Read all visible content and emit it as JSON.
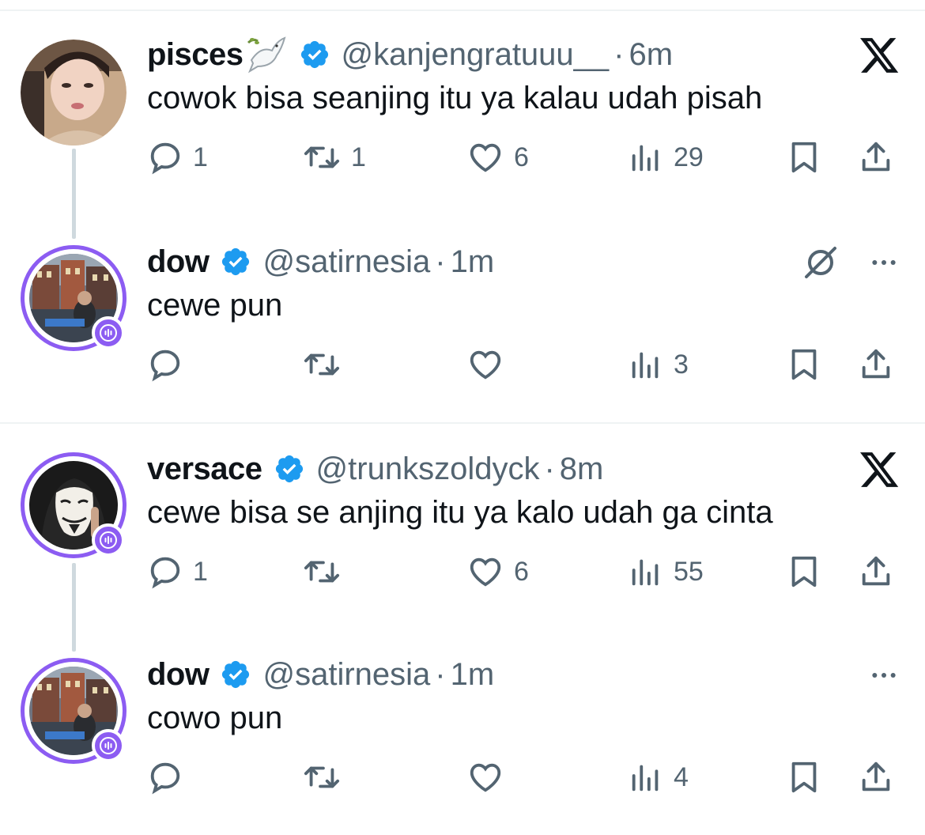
{
  "tweets": [
    {
      "name": "pisces",
      "name_emoji": "dove-icon",
      "handle": "@kanjengratuuu__",
      "separator": "·",
      "time": "6m",
      "text": "cowok bisa seanjing itu ya kalau udah pisah",
      "replies": "1",
      "retweets": "1",
      "likes": "6",
      "views": "29",
      "menu": "x-logo-icon"
    },
    {
      "name": "dow",
      "handle": "@satirnesia",
      "separator": "·",
      "time": "1m",
      "text": "cewe pun",
      "replies": "",
      "retweets": "",
      "likes": "",
      "views": "3",
      "menu": "more-icon"
    },
    {
      "name": "versace",
      "handle": "@trunkszoldyck",
      "separator": "·",
      "time": "8m",
      "text": "cewe bisa se anjing itu ya kalo udah ga cinta",
      "replies": "1",
      "retweets": "",
      "likes": "6",
      "views": "55",
      "menu": "x-logo-icon"
    },
    {
      "name": "dow",
      "handle": "@satirnesia",
      "separator": "·",
      "time": "1m",
      "text": "cowo pun",
      "replies": "",
      "retweets": "",
      "likes": "",
      "views": "4",
      "menu": "more-icon"
    }
  ],
  "colors": {
    "text": "#0f1419",
    "secondary": "#536471",
    "verified": "#1d9bf0",
    "spaces_ring": "#8c5cf2",
    "thread_line": "#cfd9de",
    "divider": "#eff3f4"
  }
}
